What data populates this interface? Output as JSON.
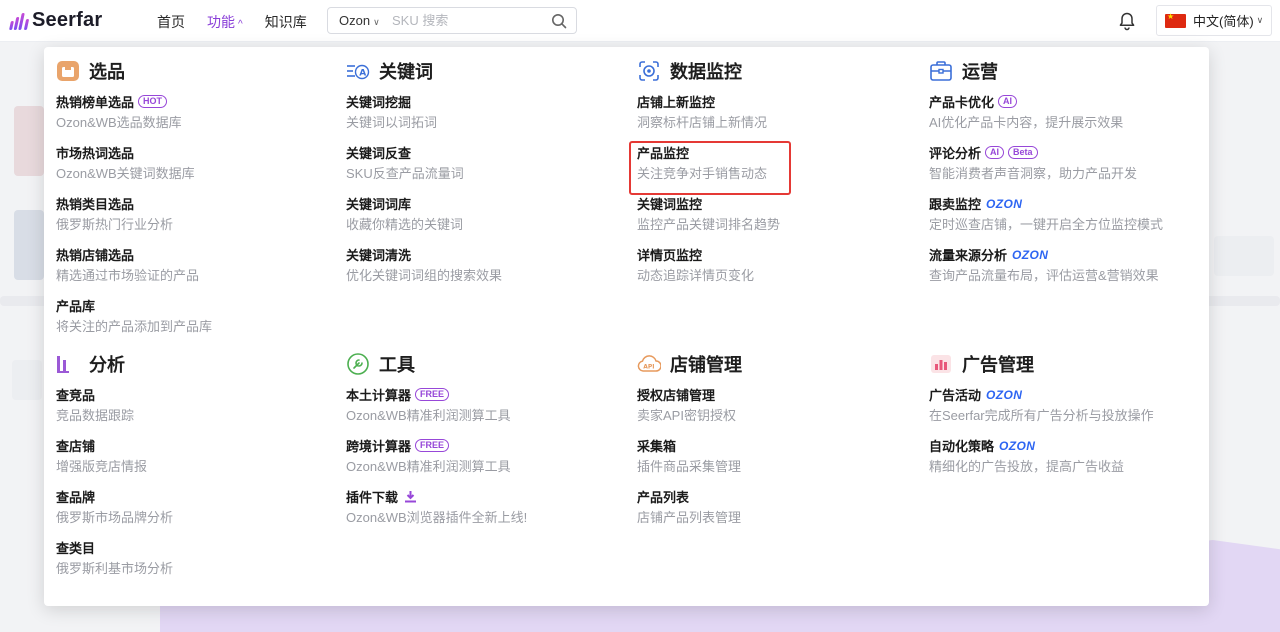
{
  "header": {
    "logo": "Seerfar",
    "nav": [
      {
        "label": "首页",
        "active": false
      },
      {
        "label": "功能",
        "active": true
      },
      {
        "label": "知识库",
        "active": false
      }
    ],
    "search": {
      "market": "Ozon",
      "placeholder": "SKU 搜索"
    },
    "language": "中文(简体)"
  },
  "colors": {
    "accent": "#8a3fd8",
    "ozon": "#2d65f2",
    "highlight": "#e53935"
  },
  "sections": [
    {
      "title": "选品",
      "icon": "box-icon",
      "items": [
        {
          "title": "热销榜单选品",
          "badges": [
            "HOT"
          ],
          "desc": "Ozon&WB选品数据库"
        },
        {
          "title": "市场热词选品",
          "desc": "Ozon&WB关键词数据库"
        },
        {
          "title": "热销类目选品",
          "desc": "俄罗斯热门行业分析"
        },
        {
          "title": "热销店铺选品",
          "desc": "精选通过市场验证的产品"
        },
        {
          "title": "产品库",
          "desc": "将关注的产品添加到产品库"
        }
      ]
    },
    {
      "title": "关键词",
      "icon": "keyword-icon",
      "items": [
        {
          "title": "关键词挖掘",
          "desc": "关键词以词拓词"
        },
        {
          "title": "关键词反查",
          "desc": "SKU反查产品流量词"
        },
        {
          "title": "关键词词库",
          "desc": "收藏你精选的关键词"
        },
        {
          "title": "关键词清洗",
          "desc": "优化关键词词组的搜索效果"
        }
      ]
    },
    {
      "title": "数据监控",
      "icon": "monitor-icon",
      "items": [
        {
          "title": "店铺上新监控",
          "desc": "洞察标杆店铺上新情况"
        },
        {
          "title": "产品监控",
          "desc": "关注竞争对手销售动态"
        },
        {
          "title": "关键词监控",
          "desc": "监控产品关键词排名趋势"
        },
        {
          "title": "详情页监控",
          "desc": "动态追踪详情页变化"
        }
      ]
    },
    {
      "title": "运营",
      "icon": "toolbox-icon",
      "items": [
        {
          "title": "产品卡优化",
          "badges": [
            "AI"
          ],
          "desc": "AI优化产品卡内容，提升展示效果"
        },
        {
          "title": "评论分析",
          "badges": [
            "AI",
            "Beta"
          ],
          "desc": "智能消费者声音洞察，助力产品开发"
        },
        {
          "title": "跟卖监控",
          "ozon": "OZON",
          "desc": "定时巡查店铺，一键开启全方位监控模式"
        },
        {
          "title": "流量来源分析",
          "ozon": "OZON",
          "desc": "查询产品流量布局，评估运营&营销效果"
        }
      ]
    },
    {
      "title": "分析",
      "icon": "bar-chart-icon",
      "items": [
        {
          "title": "查竞品",
          "desc": "竞品数据跟踪"
        },
        {
          "title": "查店铺",
          "desc": "增强版竞店情报"
        },
        {
          "title": "查品牌",
          "desc": "俄罗斯市场品牌分析"
        },
        {
          "title": "查类目",
          "desc": "俄罗斯利基市场分析"
        }
      ]
    },
    {
      "title": "工具",
      "icon": "tool-icon",
      "items": [
        {
          "title": "本土计算器",
          "badges": [
            "FREE"
          ],
          "desc": "Ozon&WB精准利润测算工具"
        },
        {
          "title": "跨境计算器",
          "badges": [
            "FREE"
          ],
          "desc": "Ozon&WB精准利润测算工具"
        },
        {
          "title": "插件下载",
          "download": true,
          "desc": "Ozon&WB浏览器插件全新上线!"
        }
      ]
    },
    {
      "title": "店铺管理",
      "icon": "api-cloud-icon",
      "items": [
        {
          "title": "授权店铺管理",
          "desc": "卖家API密钥授权"
        },
        {
          "title": "采集箱",
          "desc": "插件商品采集管理"
        },
        {
          "title": "产品列表",
          "desc": "店铺产品列表管理"
        }
      ]
    },
    {
      "title": "广告管理",
      "icon": "ad-chart-icon",
      "items": [
        {
          "title": "广告活动",
          "ozon": "OZON",
          "desc": "在Seerfar完成所有广告分析与投放操作"
        },
        {
          "title": "自动化策略",
          "ozon": "OZON",
          "desc": "精细化的广告投放，提高广告收益"
        }
      ]
    }
  ]
}
